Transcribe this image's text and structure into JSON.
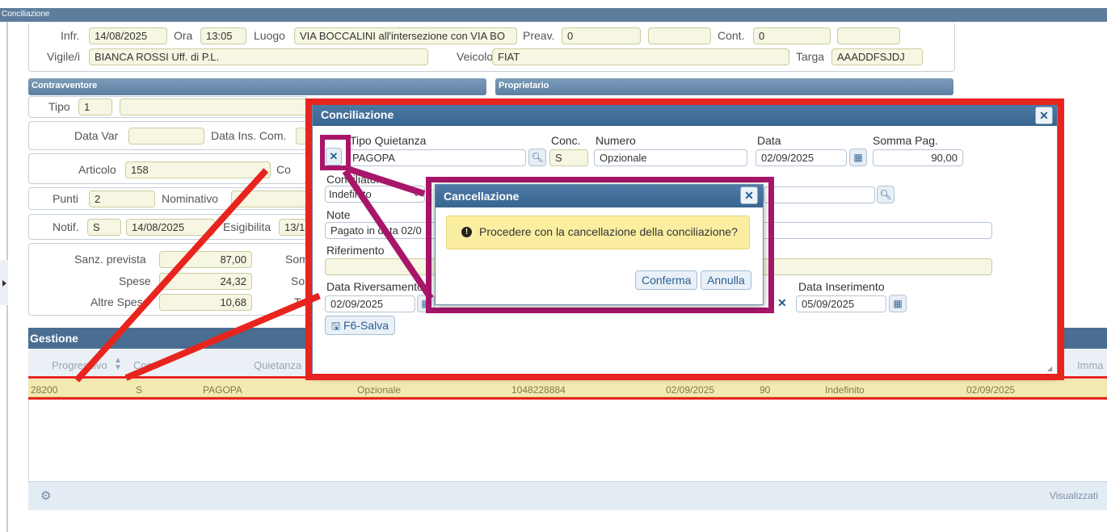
{
  "window": {
    "title": "Conciliazione"
  },
  "infr": {
    "label": "Infr.",
    "value": "14/08/2025"
  },
  "ora": {
    "label": "Ora",
    "value": "13:05"
  },
  "luogo": {
    "label": "Luogo",
    "value": "VIA BOCCALINI all'intersezione con VIA BO"
  },
  "preav": {
    "label": "Preav.",
    "value": "0"
  },
  "cont": {
    "label": "Cont.",
    "value": "0"
  },
  "vigile": {
    "label": "Vigile/i",
    "value": "BIANCA ROSSI Uff. di P.L."
  },
  "veicolo": {
    "label": "Veicolo",
    "value": "FIAT"
  },
  "targa": {
    "label": "Targa",
    "value": "AAADDFSJDJ"
  },
  "sections": {
    "contravventore": "Contravventore",
    "proprietario": "Proprietario",
    "gestione": "Gestione"
  },
  "tipo": {
    "label": "Tipo",
    "value": "1"
  },
  "data_var": {
    "label": "Data Var"
  },
  "data_ins_com": {
    "label": "Data Ins. Com."
  },
  "articolo": {
    "label": "Articolo",
    "value": "158",
    "trailing": "Co"
  },
  "punti": {
    "label": "Punti",
    "value": "2"
  },
  "nominativo": {
    "label": "Nominativo"
  },
  "notif": {
    "label": "Notif.",
    "value": "S",
    "date": "14/08/2025"
  },
  "esigibilita": {
    "label": "Esigibilita",
    "value": "13/1"
  },
  "sanz_prevista": {
    "label": "Sanz. prevista",
    "value": "87,00",
    "trailing": "Som"
  },
  "spese": {
    "label": "Spese",
    "value": "24,32",
    "trailing": "So"
  },
  "altre_spese": {
    "label": "Altre Spese",
    "value": "10,68",
    "trailing": "Ta"
  },
  "table": {
    "headers": [
      "Progressivo",
      "Conc",
      "Quietanza",
      "Imma"
    ],
    "row": [
      "28200",
      "S",
      "PAGOPA",
      "Opzionale",
      "1048228884",
      "02/09/2025",
      "90",
      "Indefinito",
      "02/09/2025"
    ],
    "footer_right": "Visualizzati"
  },
  "dialog_conc": {
    "title": "Conciliazione",
    "tipo_quietanza_label": "Tipo Quietanza",
    "tipo_quietanza_value": "PAGOPA",
    "conc_label": "Conc.",
    "conc_value": "S",
    "numero_label": "Numero",
    "numero_value": "Opzionale",
    "data_label": "Data",
    "data_value": "02/09/2025",
    "somma_label": "Somma Pag.",
    "somma_value": "90,00",
    "conciliatore_label": "Conciliatore",
    "conciliatore_value": "Indefinito",
    "note_label": "Note",
    "note_value": "Pagato in data 02/0",
    "riferimento_label": "Riferimento",
    "data_riversamento_label": "Data Riversamento",
    "data_riversamento_value": "02/09/2025",
    "data_inserimento_label": "Data Inserimento",
    "data_inserimento_value": "05/09/2025",
    "salva_label": "F6-Salva"
  },
  "dialog_cancel": {
    "title": "Cancellazione",
    "message": "Procedere con la cancellazione della conciliazione?",
    "confirm_label": "Conferma",
    "cancel_label": "Annulla"
  },
  "colors": {
    "highlight_red": "#e8241e",
    "highlight_magenta": "#a8166a",
    "header_blue": "#4a6e92"
  }
}
